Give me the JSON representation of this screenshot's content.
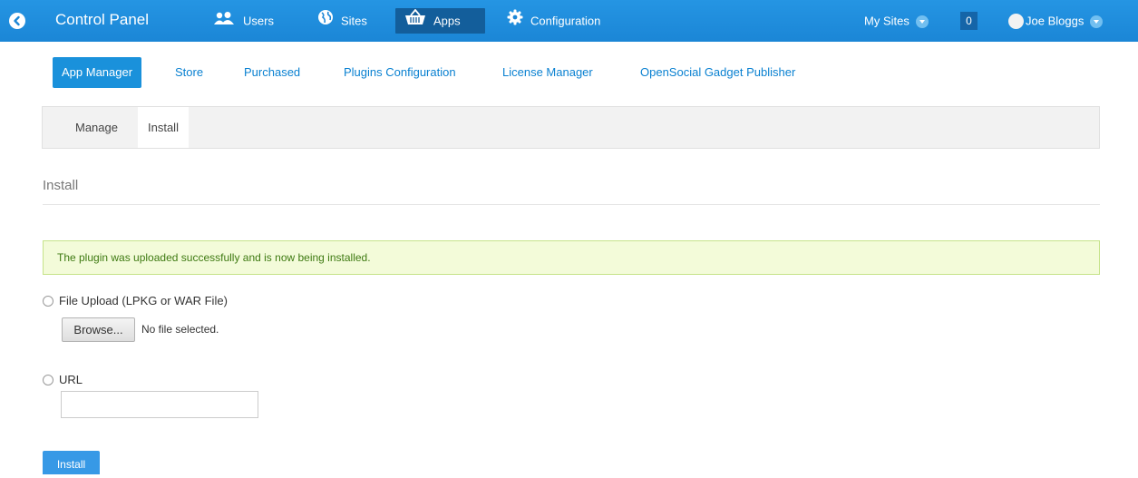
{
  "topbar": {
    "brand": "Control Panel",
    "nav": [
      {
        "label": "Users",
        "icon": "users-icon"
      },
      {
        "label": "Sites",
        "icon": "globe-icon"
      },
      {
        "label": "Apps",
        "icon": "basket-icon"
      },
      {
        "label": "Configuration",
        "icon": "gear-icon"
      }
    ],
    "active_nav": "Apps",
    "my_sites": "My Sites",
    "notification_count": "0",
    "user_name": "Joe Bloggs",
    "colors": {
      "bar": "#1f8fde",
      "active": "#135e9b"
    }
  },
  "subnav": {
    "items": [
      "App Manager",
      "Store",
      "Purchased",
      "Plugins Configuration",
      "License Manager",
      "OpenSocial Gadget Publisher"
    ],
    "active": "App Manager"
  },
  "tertiary": {
    "items": [
      "Manage",
      "Install"
    ],
    "active": "Install"
  },
  "main": {
    "title": "Install",
    "alert": "The plugin was uploaded successfully and is now being installed.",
    "file_upload_label": "File Upload (LPKG or WAR File)",
    "browse_label": "Browse...",
    "file_status": "No file selected.",
    "url_label": "URL",
    "url_value": "",
    "install_button": "Install"
  }
}
